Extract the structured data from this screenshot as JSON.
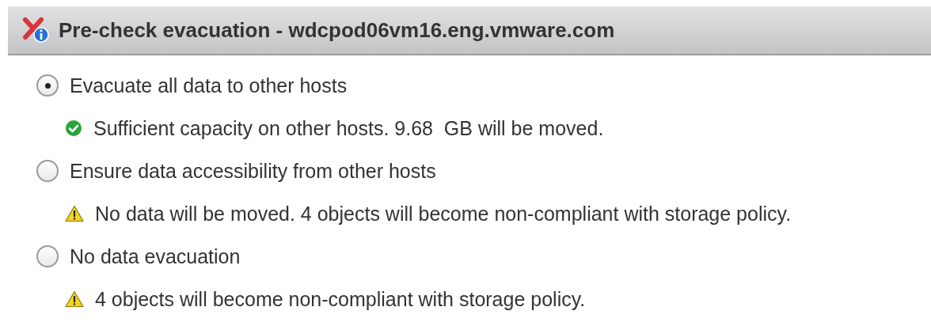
{
  "window": {
    "title": "Pre-check evacuation - wdcpod06vm16.eng.vmware.com"
  },
  "options": [
    {
      "label": "Evacuate all data to other hosts",
      "selected": true,
      "status": {
        "kind": "success",
        "text": "Sufficient capacity on other hosts. 9.68  GB will be moved."
      }
    },
    {
      "label": "Ensure data accessibility from other hosts",
      "selected": false,
      "status": {
        "kind": "warning",
        "text": "No data will be moved. 4 objects will become non-compliant with storage policy."
      }
    },
    {
      "label": "No data evacuation",
      "selected": false,
      "status": {
        "kind": "warning",
        "text": "4 objects will become non-compliant with storage policy."
      }
    }
  ]
}
